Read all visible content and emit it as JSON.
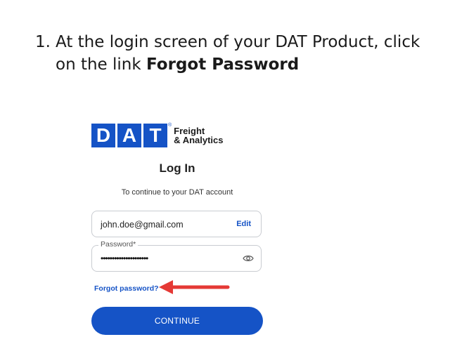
{
  "instruction": {
    "number": "1.",
    "text_before": "At the login screen of your DAT Product, click on the link ",
    "link_text": "Forgot Password"
  },
  "login": {
    "logo_letters": [
      "D",
      "A",
      "T"
    ],
    "logo_registered": "®",
    "logo_line1": "Freight",
    "logo_line2": "& Analytics",
    "title": "Log In",
    "subtitle": "To continue to your DAT account",
    "email_value": "john.doe@gmail.com",
    "edit_label": "Edit",
    "password_label": "Password*",
    "password_mask": "•••••••••••••••••••••",
    "forgot_label": "Forgot password?",
    "continue_label": "CONTINUE"
  },
  "icons": {
    "eye": "eye-icon",
    "arrow": "arrow-left-icon"
  },
  "colors": {
    "brand_blue": "#1553c6",
    "arrow_red": "#e53935"
  }
}
